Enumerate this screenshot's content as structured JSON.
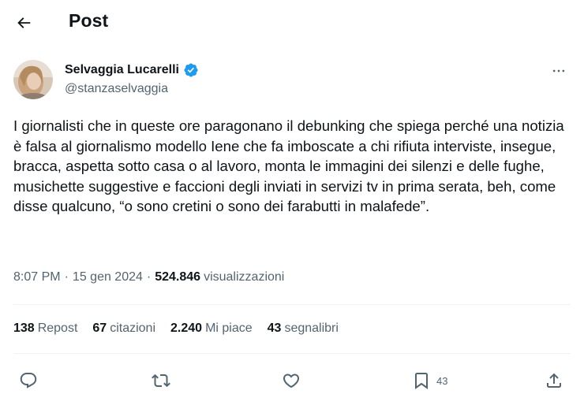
{
  "header": {
    "title": "Post"
  },
  "author": {
    "name": "Selvaggia Lucarelli",
    "handle": "@stanzaselvaggia"
  },
  "post": {
    "text": "I giornalisti che in queste ore paragonano il debunking che spiega perché una notizia è falsa al giornalismo modello Iene che fa imboscate a chi rifiuta interviste, insegue, bracca, aspetta sotto casa o al lavoro, monta le immagini dei silenzi e delle fughe, musichette suggestive e faccioni degli inviati in servizi tv in prima serata, beh, come disse qualcuno, “o sono cretini o sono dei farabutti in malafede”."
  },
  "meta": {
    "time": "8:07 PM",
    "separator": "·",
    "date": "15 gen 2024",
    "views_count": "524.846",
    "views_label": "visualizzazioni"
  },
  "stats": {
    "reposts": {
      "count": "138",
      "label": "Repost"
    },
    "quotes": {
      "count": "67",
      "label": "citazioni"
    },
    "likes": {
      "count": "2.240",
      "label": "Mi piace"
    },
    "bookmarks": {
      "count": "43",
      "label": "segnalibri"
    }
  },
  "actions": {
    "bookmark_count": "43"
  },
  "icons": {
    "back": "back-arrow-icon",
    "verified": "verified-badge-icon",
    "more": "more-horizontal-icon",
    "reply": "reply-bubble-icon",
    "repost": "repost-icon",
    "like": "heart-icon",
    "bookmark": "bookmark-icon",
    "share": "share-icon"
  },
  "colors": {
    "text_primary": "#0f1419",
    "text_secondary": "#536471",
    "verified_blue": "#1d9bf0",
    "divider": "#eff3f4"
  }
}
